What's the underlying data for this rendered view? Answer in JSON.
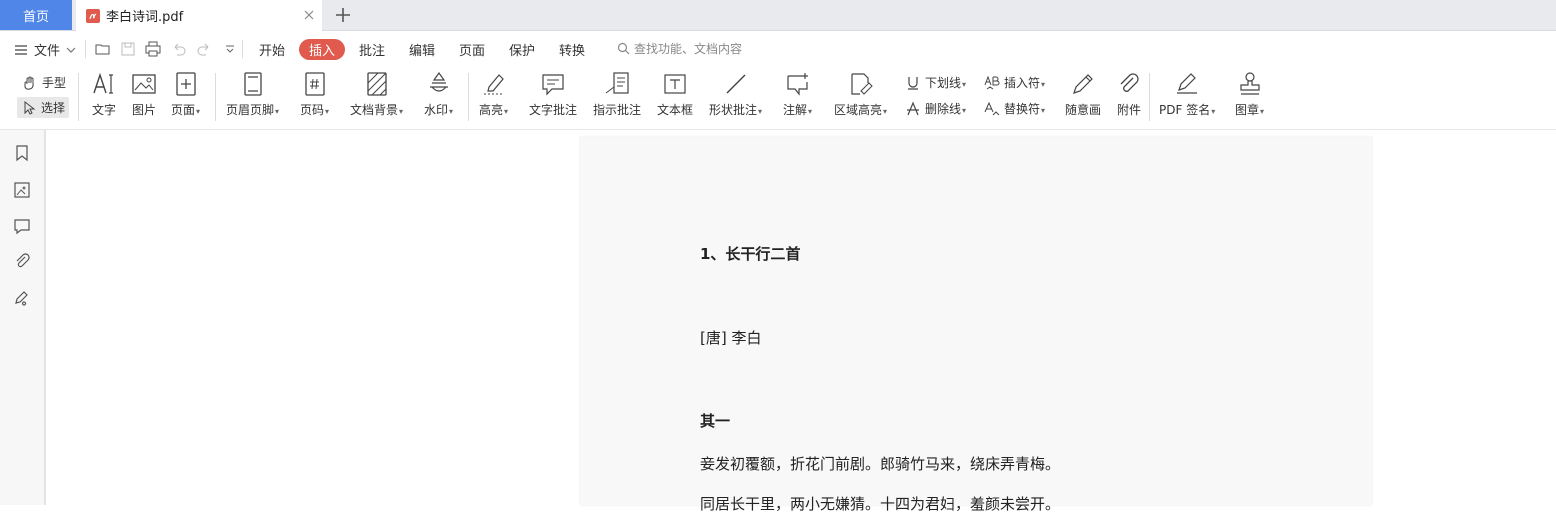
{
  "tabs": {
    "home": "首页",
    "document": "李白诗词.pdf"
  },
  "menu": {
    "file": "文件",
    "tabs": [
      "开始",
      "插入",
      "批注",
      "编辑",
      "页面",
      "保护",
      "转换"
    ],
    "search_placeholder": "查找功能、文档内容"
  },
  "ribbon": {
    "hand": "手型",
    "select": "选择",
    "text": "文字",
    "image": "图片",
    "page": "页面",
    "header_footer": "页眉页脚",
    "page_number": "页码",
    "background": "文档背景",
    "watermark": "水印",
    "highlight": "高亮",
    "text_comment": "文字批注",
    "pointer_comment": "指示批注",
    "textbox": "文本框",
    "shape_comment": "形状批注",
    "note": "注解",
    "area_highlight": "区域高亮",
    "underline": "下划线",
    "strikethrough": "删除线",
    "insert_mark": "插入符",
    "replace_mark": "替换符",
    "freehand": "随意画",
    "attachment": "附件",
    "pdf_sign": "PDF 签名",
    "stamp": "图章"
  },
  "document": {
    "heading": "1、长干行二首",
    "author": "[唐] 李白",
    "part": "其一",
    "line1": "妾发初覆额，折花门前剧。郎骑竹马来，绕床弄青梅。",
    "line2": "同居长干里，两小无嫌猜。十四为君妇，羞颜未尝开。"
  },
  "colors": {
    "accent_red": "#e05a4e",
    "home_blue": "#4f86e8"
  }
}
